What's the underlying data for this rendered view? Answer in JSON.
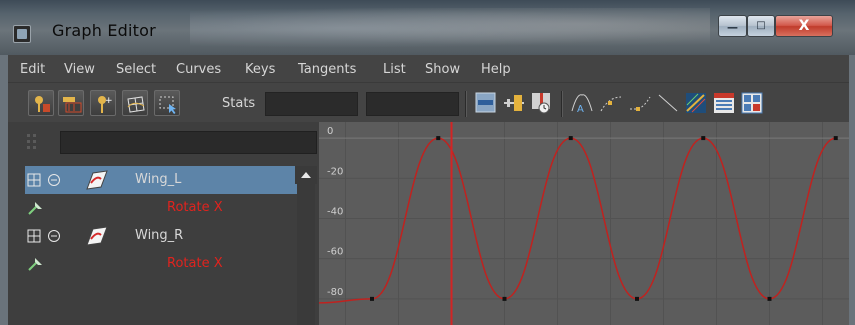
{
  "window": {
    "title": "Graph Editor",
    "controls": {
      "minimize": "—",
      "maximize": "□",
      "close": "X"
    }
  },
  "menu": [
    "Edit",
    "View",
    "Select",
    "Curves",
    "Keys",
    "Tangents",
    "List",
    "Show",
    "Help"
  ],
  "toolbar": {
    "stats_label": "Stats",
    "stats_field_1": "",
    "stats_field_2": "",
    "left_icons": [
      "move-key-icon",
      "insert-key-icon",
      "add-key-icon",
      "lattice-deform-icon",
      "region-select-icon"
    ],
    "right_icons": [
      "frame-all-icon",
      "frame-selection-icon",
      "frame-playback-icon",
      "auto-tangent-icon",
      "spline-tangent-icon",
      "clamped-tangent-icon",
      "linear-tangent-icon",
      "plateau-tangent-icon",
      "dope-sheet-icon",
      "trax-editor-icon"
    ]
  },
  "outliner": {
    "filter_value": "",
    "rows": [
      {
        "type": "node",
        "label": "Wing_L",
        "selected": true
      },
      {
        "type": "attr",
        "label": "Rotate X"
      },
      {
        "type": "node",
        "label": "Wing_R",
        "selected": false
      },
      {
        "type": "attr",
        "label": "Rotate X"
      }
    ]
  },
  "colors": {
    "curve": "#c0221f",
    "selection": "#5d84a8",
    "attribute_text": "#e0231e",
    "current_time": "#d32424"
  },
  "chart_data": {
    "type": "line",
    "title": "",
    "xlabel": "",
    "ylabel": "",
    "y_ticks": [
      "0",
      "-20",
      "-40",
      "-60",
      "-80"
    ],
    "ylim": [
      -93,
      8
    ],
    "xlim": [
      0,
      20
    ],
    "grid": true,
    "series": [
      {
        "keys": [
          {
            "x": 2.0,
            "y": -80
          },
          {
            "x": 4.5,
            "y": 0
          },
          {
            "x": 7.0,
            "y": -80
          },
          {
            "x": 9.5,
            "y": 0
          },
          {
            "x": 12.0,
            "y": -80
          },
          {
            "x": 14.5,
            "y": 0
          },
          {
            "x": 17.0,
            "y": -80
          },
          {
            "x": 19.5,
            "y": 0
          }
        ]
      }
    ],
    "current_time": 5.0
  }
}
